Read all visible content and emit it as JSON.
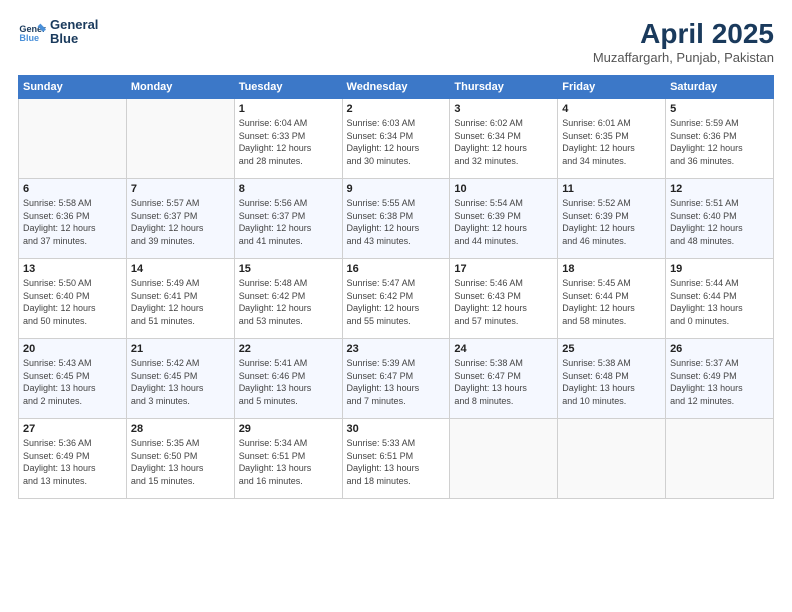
{
  "header": {
    "logo_line1": "General",
    "logo_line2": "Blue",
    "month_title": "April 2025",
    "subtitle": "Muzaffargarh, Punjab, Pakistan"
  },
  "weekdays": [
    "Sunday",
    "Monday",
    "Tuesday",
    "Wednesday",
    "Thursday",
    "Friday",
    "Saturday"
  ],
  "weeks": [
    [
      {
        "num": "",
        "info": ""
      },
      {
        "num": "",
        "info": ""
      },
      {
        "num": "1",
        "info": "Sunrise: 6:04 AM\nSunset: 6:33 PM\nDaylight: 12 hours\nand 28 minutes."
      },
      {
        "num": "2",
        "info": "Sunrise: 6:03 AM\nSunset: 6:34 PM\nDaylight: 12 hours\nand 30 minutes."
      },
      {
        "num": "3",
        "info": "Sunrise: 6:02 AM\nSunset: 6:34 PM\nDaylight: 12 hours\nand 32 minutes."
      },
      {
        "num": "4",
        "info": "Sunrise: 6:01 AM\nSunset: 6:35 PM\nDaylight: 12 hours\nand 34 minutes."
      },
      {
        "num": "5",
        "info": "Sunrise: 5:59 AM\nSunset: 6:36 PM\nDaylight: 12 hours\nand 36 minutes."
      }
    ],
    [
      {
        "num": "6",
        "info": "Sunrise: 5:58 AM\nSunset: 6:36 PM\nDaylight: 12 hours\nand 37 minutes."
      },
      {
        "num": "7",
        "info": "Sunrise: 5:57 AM\nSunset: 6:37 PM\nDaylight: 12 hours\nand 39 minutes."
      },
      {
        "num": "8",
        "info": "Sunrise: 5:56 AM\nSunset: 6:37 PM\nDaylight: 12 hours\nand 41 minutes."
      },
      {
        "num": "9",
        "info": "Sunrise: 5:55 AM\nSunset: 6:38 PM\nDaylight: 12 hours\nand 43 minutes."
      },
      {
        "num": "10",
        "info": "Sunrise: 5:54 AM\nSunset: 6:39 PM\nDaylight: 12 hours\nand 44 minutes."
      },
      {
        "num": "11",
        "info": "Sunrise: 5:52 AM\nSunset: 6:39 PM\nDaylight: 12 hours\nand 46 minutes."
      },
      {
        "num": "12",
        "info": "Sunrise: 5:51 AM\nSunset: 6:40 PM\nDaylight: 12 hours\nand 48 minutes."
      }
    ],
    [
      {
        "num": "13",
        "info": "Sunrise: 5:50 AM\nSunset: 6:40 PM\nDaylight: 12 hours\nand 50 minutes."
      },
      {
        "num": "14",
        "info": "Sunrise: 5:49 AM\nSunset: 6:41 PM\nDaylight: 12 hours\nand 51 minutes."
      },
      {
        "num": "15",
        "info": "Sunrise: 5:48 AM\nSunset: 6:42 PM\nDaylight: 12 hours\nand 53 minutes."
      },
      {
        "num": "16",
        "info": "Sunrise: 5:47 AM\nSunset: 6:42 PM\nDaylight: 12 hours\nand 55 minutes."
      },
      {
        "num": "17",
        "info": "Sunrise: 5:46 AM\nSunset: 6:43 PM\nDaylight: 12 hours\nand 57 minutes."
      },
      {
        "num": "18",
        "info": "Sunrise: 5:45 AM\nSunset: 6:44 PM\nDaylight: 12 hours\nand 58 minutes."
      },
      {
        "num": "19",
        "info": "Sunrise: 5:44 AM\nSunset: 6:44 PM\nDaylight: 13 hours\nand 0 minutes."
      }
    ],
    [
      {
        "num": "20",
        "info": "Sunrise: 5:43 AM\nSunset: 6:45 PM\nDaylight: 13 hours\nand 2 minutes."
      },
      {
        "num": "21",
        "info": "Sunrise: 5:42 AM\nSunset: 6:45 PM\nDaylight: 13 hours\nand 3 minutes."
      },
      {
        "num": "22",
        "info": "Sunrise: 5:41 AM\nSunset: 6:46 PM\nDaylight: 13 hours\nand 5 minutes."
      },
      {
        "num": "23",
        "info": "Sunrise: 5:39 AM\nSunset: 6:47 PM\nDaylight: 13 hours\nand 7 minutes."
      },
      {
        "num": "24",
        "info": "Sunrise: 5:38 AM\nSunset: 6:47 PM\nDaylight: 13 hours\nand 8 minutes."
      },
      {
        "num": "25",
        "info": "Sunrise: 5:38 AM\nSunset: 6:48 PM\nDaylight: 13 hours\nand 10 minutes."
      },
      {
        "num": "26",
        "info": "Sunrise: 5:37 AM\nSunset: 6:49 PM\nDaylight: 13 hours\nand 12 minutes."
      }
    ],
    [
      {
        "num": "27",
        "info": "Sunrise: 5:36 AM\nSunset: 6:49 PM\nDaylight: 13 hours\nand 13 minutes."
      },
      {
        "num": "28",
        "info": "Sunrise: 5:35 AM\nSunset: 6:50 PM\nDaylight: 13 hours\nand 15 minutes."
      },
      {
        "num": "29",
        "info": "Sunrise: 5:34 AM\nSunset: 6:51 PM\nDaylight: 13 hours\nand 16 minutes."
      },
      {
        "num": "30",
        "info": "Sunrise: 5:33 AM\nSunset: 6:51 PM\nDaylight: 13 hours\nand 18 minutes."
      },
      {
        "num": "",
        "info": ""
      },
      {
        "num": "",
        "info": ""
      },
      {
        "num": "",
        "info": ""
      }
    ]
  ]
}
